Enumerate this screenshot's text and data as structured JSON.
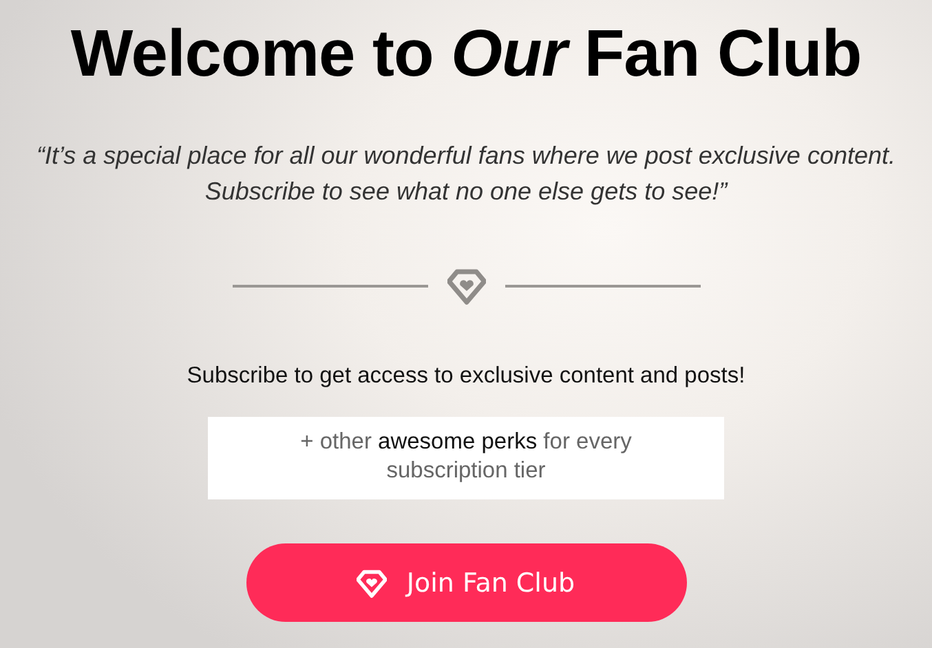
{
  "title": "Welcome to *Our* Fan Club",
  "quote": "“It’s a special place for all our wonderful fans where we post exclusive content. Subscribe to see what no one else gets to see!”",
  "subscribe_text": "Subscribe to get access to exclusive content and posts!",
  "perks_text": "+ other **awesome perks** for every subscription tier",
  "join_button": {
    "label": "Join Fan Club"
  }
}
